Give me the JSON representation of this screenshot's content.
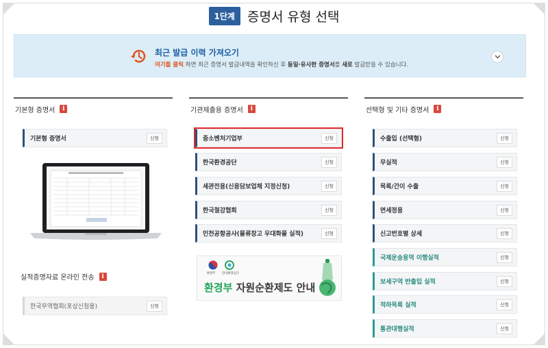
{
  "step": {
    "badge": "1단계",
    "title": "증명서 유형 선택"
  },
  "history": {
    "title": "최근 발급 이력 가져오기",
    "desc_highlight": "여기를 클릭",
    "desc_part1": " 하면 최근 증명서 발급내역을 확인하신 후 ",
    "desc_bold1": "동일·유사한 증명서",
    "desc_part2": "를 ",
    "desc_bold2": "새로",
    "desc_part3": " 발급받을 수 있습니다.",
    "icon": "history-icon"
  },
  "apply_label": "신청",
  "columns": {
    "basic": {
      "title": "기본형 증명서",
      "items": [
        {
          "label": "기본형 증명서"
        }
      ],
      "section2_title": "실적증명자료 온라인 전송",
      "section2_items": [
        {
          "label": "한국무역협회(포상신청용)"
        }
      ]
    },
    "agency": {
      "title": "기관제출용 증명서",
      "items": [
        {
          "label": "중소벤처기업부"
        },
        {
          "label": "한국환경공단"
        },
        {
          "label": "세관전용(신용담보업체 지정신청)"
        },
        {
          "label": "한국철강협회"
        },
        {
          "label": "인천공항공사(물류창고 우대화물 실적)"
        }
      ]
    },
    "other": {
      "title": "선택형 및 기타 증명서",
      "items": [
        {
          "label": "수출입 (선택형)"
        },
        {
          "label": "무실적"
        },
        {
          "label": "목록/간이 수출"
        },
        {
          "label": "면세정용"
        },
        {
          "label": "신고번호별 상세"
        },
        {
          "label": "국제운송용역 이행실적"
        },
        {
          "label": "보세구역 반출입 실적"
        },
        {
          "label": "적하목록 실적"
        },
        {
          "label": "통관대행실적"
        }
      ]
    }
  },
  "banner": {
    "org1": "환경부",
    "org2": "한국환경공단",
    "text_green": "환경부",
    "text_rest": " 자원순환제도 안내"
  },
  "colors": {
    "primary": "#2c5f9e",
    "accent": "#e05522",
    "teal": "#2b9a8e",
    "highlight_border": "#e02b2b"
  }
}
